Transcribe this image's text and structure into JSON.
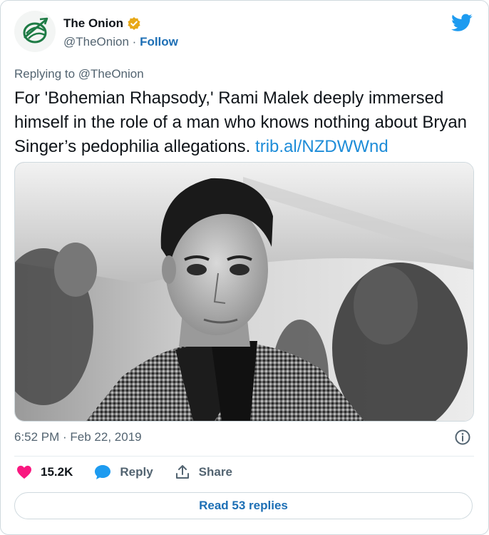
{
  "author": {
    "name": "The Onion",
    "handle": "@TheOnion",
    "separator": "·",
    "follow_label": "Follow",
    "verified_color": "#e8a817"
  },
  "reply_context": "Replying to @TheOnion",
  "tweet": {
    "text": "For 'Bohemian Rhapsody,' Rami Malek deeply immersed himself in the role of a man who knows nothing about Bryan Singer’s pedophilia allegations.",
    "link": "trib.al/NZDWWnd"
  },
  "timestamp": "6:52 PM · Feb 22, 2019",
  "actions": {
    "like_count": "15.2K",
    "reply_label": "Reply",
    "share_label": "Share"
  },
  "read_replies_label": "Read 53 replies",
  "colors": {
    "accent": "#1d6fb5",
    "link": "#1d8cd8",
    "heart": "#f91880",
    "twitter_blue": "#1d9bf0",
    "onion_green": "#1e7b45"
  },
  "icons": {
    "logo": "onion-logo-icon",
    "verified": "verified-badge-icon",
    "brand": "twitter-bird-icon",
    "info": "info-icon",
    "like": "heart-icon",
    "reply": "reply-bubble-icon",
    "share": "share-icon"
  }
}
